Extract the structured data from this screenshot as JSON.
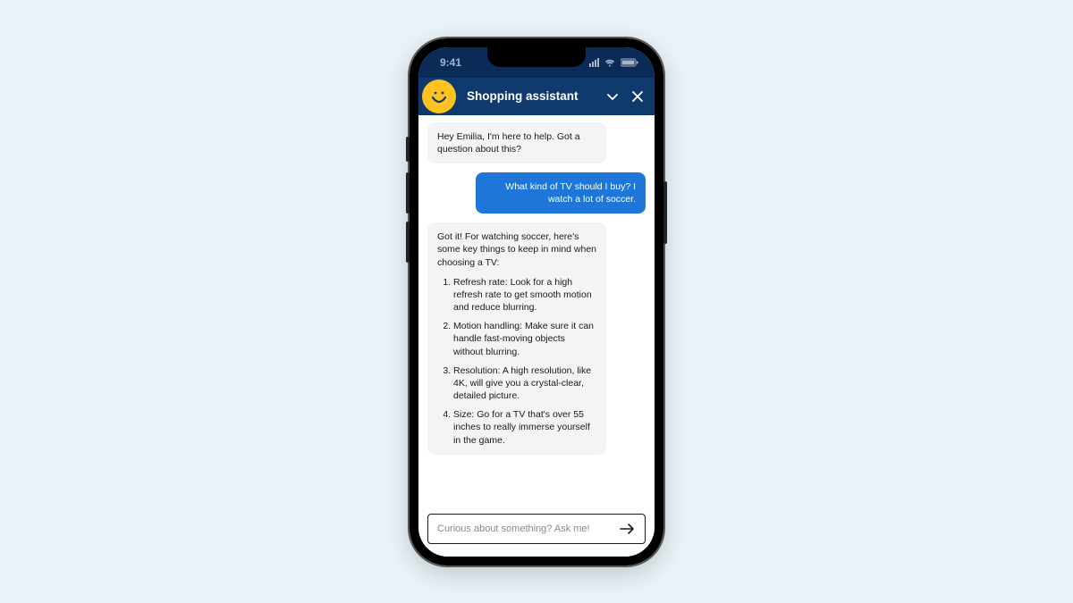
{
  "status": {
    "time": "9:41"
  },
  "header": {
    "title": "Shopping assistant",
    "avatar_icon": "spark-smiley"
  },
  "messages": {
    "greeting": "Hey Emilia, I'm here to help. Got a question about this?",
    "user_question": "What kind of TV should I buy? I watch a lot of soccer.",
    "response_intro": "Got it! For watching soccer, here's some key things to keep in mind when choosing a TV:",
    "tips": [
      "Refresh rate: Look for a high refresh rate to get smooth motion and reduce blurring.",
      "Motion handling: Make sure it can handle fast-moving objects without blurring.",
      "Resolution: A high resolution, like 4K, will give you a crystal-clear, detailed picture.",
      "Size: Go for a TV that's over 55 inches to really immerse yourself in the game."
    ]
  },
  "input": {
    "placeholder": "Curious about something? Ask me!"
  }
}
